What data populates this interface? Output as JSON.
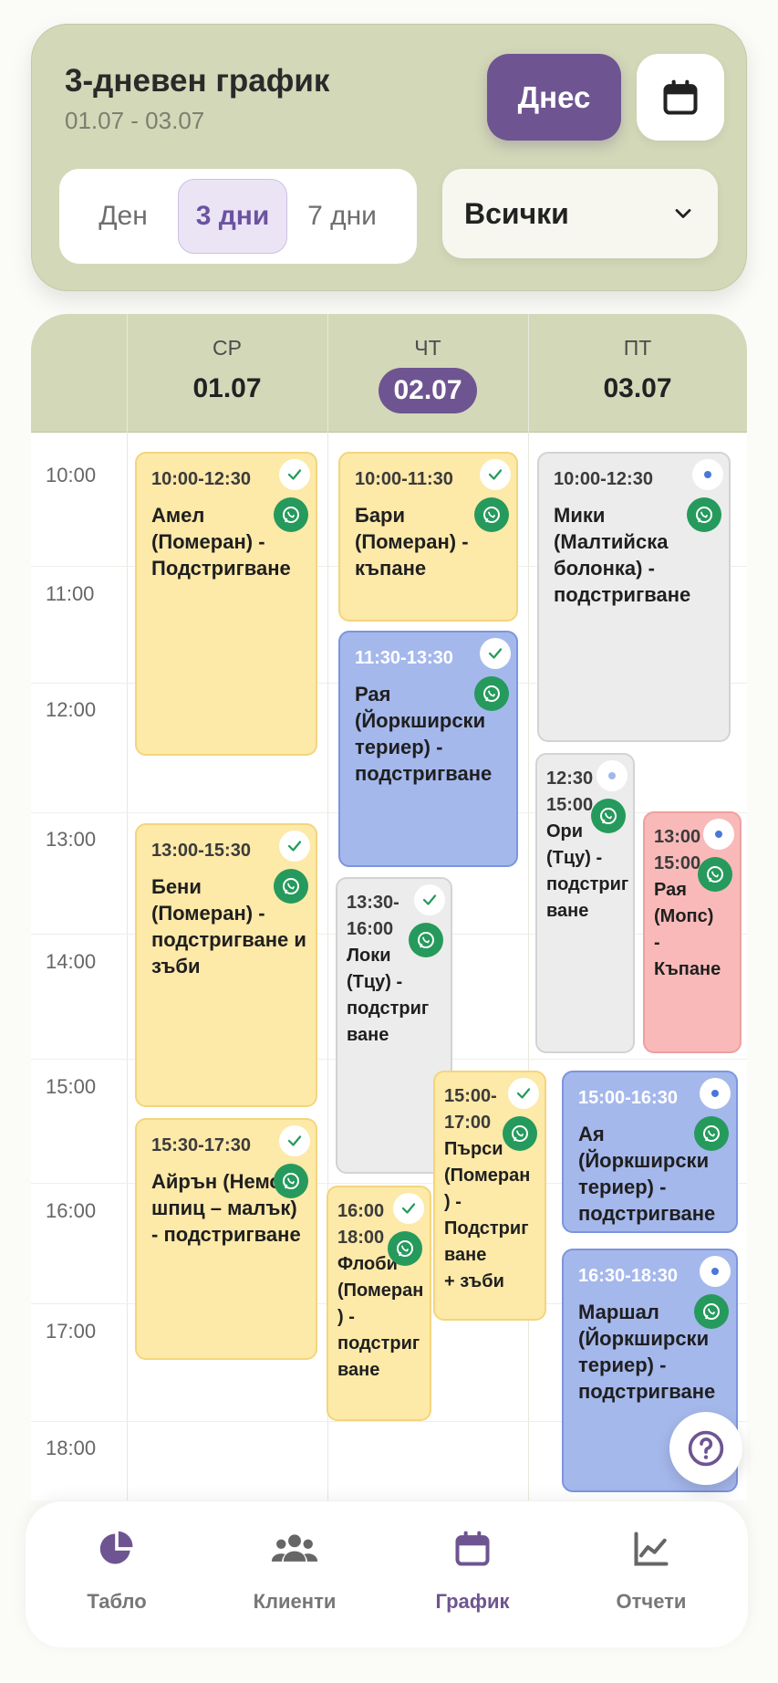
{
  "header": {
    "title": "3-дневен график",
    "range": "01.07 - 03.07",
    "today_label": "Днес",
    "view_options": [
      "Ден",
      "3 дни",
      "7 дни"
    ],
    "active_view": "3 дни",
    "filter_value": "Всички"
  },
  "days": [
    {
      "dow": "СР",
      "date": "01.07",
      "today": false
    },
    {
      "dow": "ЧТ",
      "date": "02.07",
      "today": true
    },
    {
      "dow": "ПТ",
      "date": "03.07",
      "today": false
    }
  ],
  "times": [
    "10:00",
    "11:00",
    "12:00",
    "13:00",
    "14:00",
    "15:00",
    "16:00",
    "17:00",
    "18:00"
  ],
  "events": [
    {
      "time": "10:00-12:30",
      "title": "Амел (Померан) - Подстригване",
      "status": "confirmed"
    },
    {
      "time": "13:00-15:30",
      "title": "Бени (Померан) - подстригване и зъби",
      "status": "confirmed"
    },
    {
      "time": "15:30-17:30",
      "title": "Айрън (Немски шпиц – малък) - подстригване",
      "status": "confirmed"
    },
    {
      "time": "10:00-11:30",
      "title": "Бари (Померан) - къпане",
      "status": "confirmed"
    },
    {
      "time": "11:30-13:30",
      "title": "Рая (Йоркширски териер) - подстригване",
      "status": "confirmed"
    },
    {
      "time_start": "13:30-",
      "time_end": "16:00",
      "title_lines": [
        "Локи",
        "(Тцу) -",
        "подстриг",
        "ване"
      ],
      "status": "confirmed"
    },
    {
      "time_start": "15:00-",
      "time_end": "17:00",
      "title_lines": [
        "Пърси",
        "(Померан",
        ") -",
        "Подстриг",
        "ване",
        "+ зъби"
      ],
      "status": "confirmed"
    },
    {
      "time_start": "16:00",
      "time_end": "18:00",
      "title_lines": [
        "Флоби",
        "(Померан",
        ") -",
        "подстриг",
        "ване"
      ],
      "status": "confirmed"
    },
    {
      "time": "10:00-12:30",
      "title": "Мики (Малтийска болонка) - подстригване",
      "status": "pending"
    },
    {
      "time_start": "12:30",
      "time_end": "15:00",
      "title_lines": [
        "Ори",
        "(Тцу) -",
        "подстриг",
        "ване"
      ],
      "status": "pending"
    },
    {
      "time_start": "13:00",
      "time_end": "15:00",
      "title_lines": [
        "Рая",
        "(Мопс)",
        "-",
        "Къпане"
      ],
      "status": "pending"
    },
    {
      "time": "15:00-16:30",
      "title": "Ая (Йоркширски териер) - подстригване",
      "status": "pending"
    },
    {
      "time": "16:30-18:30",
      "title": "Маршал (Йоркширски териер) - подстригване",
      "status": "pending"
    }
  ],
  "nav": [
    {
      "label": "Табло",
      "icon": "pie-chart-icon"
    },
    {
      "label": "Клиенти",
      "icon": "users-icon"
    },
    {
      "label": "График",
      "icon": "calendar-icon"
    },
    {
      "label": "Отчети",
      "icon": "line-chart-icon"
    }
  ],
  "colors": {
    "accent": "#6e5591",
    "header_bg": "#d3d8b8",
    "yellow": "#fde9a8",
    "blue": "#a5b8ec",
    "grey": "#ececec",
    "red": "#f9b9b9",
    "whatsapp": "#259a5c"
  }
}
